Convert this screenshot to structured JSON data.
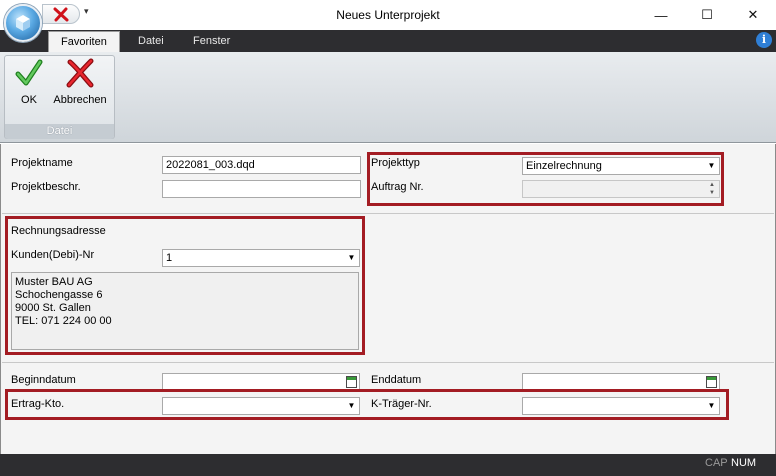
{
  "window": {
    "title": "Neues Unterprojekt",
    "minimize_glyph": "—",
    "maximize_glyph": "☐",
    "close_glyph": "✕"
  },
  "qat": {
    "dropdown_glyph": "▾"
  },
  "tabs": [
    {
      "label": "Favoriten",
      "active": true
    },
    {
      "label": "Datei",
      "active": false
    },
    {
      "label": "Fenster",
      "active": false
    }
  ],
  "info_glyph": "i",
  "ribbon": {
    "group_label": "Datei",
    "ok_label": "OK",
    "cancel_label": "Abbrechen"
  },
  "form": {
    "projektname_label": "Projektname",
    "projektname_value": "2022081_003.dqd",
    "projektbeschr_label": "Projektbeschr.",
    "projektbeschr_value": "",
    "projekttyp_label": "Projekttyp",
    "projekttyp_value": "Einzelrechnung",
    "auftrag_label": "Auftrag Nr.",
    "auftrag_value": "",
    "rechnungsadresse_label": "Rechnungsadresse",
    "kunden_label": "Kunden(Debi)-Nr",
    "kunden_value": "1",
    "address_lines": [
      "Muster BAU AG",
      "Schochengasse 6",
      "9000 St. Gallen",
      "TEL: 071 224 00 00"
    ],
    "beginndatum_label": "Beginndatum",
    "beginndatum_value": "",
    "enddatum_label": "Enddatum",
    "enddatum_value": "",
    "ertrag_label": "Ertrag-Kto.",
    "ertrag_value": "",
    "ktraeger_label": "K-Träger-Nr.",
    "ktraeger_value": ""
  },
  "status": {
    "cap": "CAP",
    "num": "NUM"
  },
  "colors": {
    "highlight_box": "#a31c23",
    "dark_chrome": "#2d2d30",
    "ribbon": "#dde2e6"
  }
}
